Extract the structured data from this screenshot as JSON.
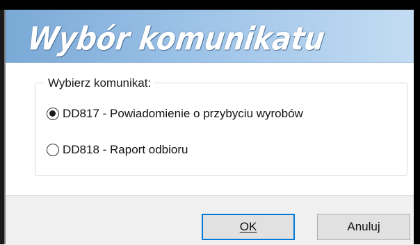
{
  "dialog": {
    "title": "Wybór komunikatu"
  },
  "group": {
    "legend": "Wybierz komunikat:",
    "options": [
      {
        "label": "DD817 - Powiadomienie o przybyciu wyrobów",
        "checked": true
      },
      {
        "label": "DD818 - Raport odbioru",
        "checked": false
      }
    ]
  },
  "buttons": {
    "ok_label": "OK",
    "cancel_label": "Anuluj"
  },
  "colors": {
    "banner_gradient_start": "#7aa9d6",
    "banner_gradient_end": "#c3dcf3",
    "default_button_border": "#0078d7"
  }
}
